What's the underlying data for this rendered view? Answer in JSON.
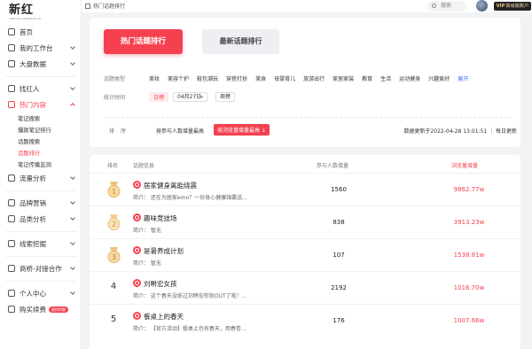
{
  "logo": {
    "main": "新红",
    "sub": "XINHONG.NEWRANK.CN"
  },
  "sidebar": {
    "items": [
      {
        "label": "首页",
        "icon": "home-icon",
        "arrow": false
      },
      {
        "label": "我的工作台",
        "icon": "workbench-icon",
        "arrow": true
      },
      {
        "label": "大盘数据",
        "icon": "dashboard-icon",
        "arrow": true
      },
      {
        "label": "找红人",
        "icon": "user-search-icon",
        "arrow": true
      },
      {
        "label": "热门内容",
        "icon": "hot-content-icon",
        "arrow": true,
        "active": true
      }
    ],
    "sub_items": [
      {
        "label": "笔记搜索"
      },
      {
        "label": "爆款笔记排行"
      },
      {
        "label": "话题搜索"
      },
      {
        "label": "话题排行",
        "active": true
      },
      {
        "label": "笔记传播监测"
      }
    ],
    "items2": [
      {
        "label": "流量分析",
        "icon": "traffic-icon"
      },
      {
        "label": "品牌营销",
        "icon": "brand-icon"
      },
      {
        "label": "品类分析",
        "icon": "category-icon"
      },
      {
        "label": "线索挖掘",
        "icon": "clue-icon"
      },
      {
        "label": "商桥-对接合作",
        "icon": "handshake-icon"
      },
      {
        "label": "个人中心",
        "icon": "person-icon"
      },
      {
        "label": "购买续费",
        "icon": "cart-icon",
        "badge": "限时特惠"
      }
    ]
  },
  "topbar": {
    "breadcrumb": "热门话题排行",
    "search_placeholder": "搜索",
    "vip_prefix": "VIP",
    "vip_label": "高级版账户"
  },
  "tabs": {
    "hot": "热门话题排行",
    "new": "最新话题排行"
  },
  "filters": {
    "type_label": "话题类型",
    "types": [
      "美妆",
      "美容个护",
      "鞋包潮玩",
      "穿搭打扮",
      "美食",
      "母婴育儿",
      "旅游出行",
      "家居家装",
      "教育",
      "生活",
      "运动健身",
      "兴趣爱好"
    ],
    "expand": "展开",
    "time_label": "统计时间",
    "day": "日榜",
    "date": "04月27日",
    "week": "周榜"
  },
  "sort": {
    "label": "排序",
    "option1": "按参与人数增量最高",
    "option2": "按浏览量增量最高 ↓",
    "update_time": "数据更新于2022-04-28 13:01:51 ｜ 每日更新"
  },
  "table": {
    "headers": [
      "排名",
      "话题信息",
      "参与人数增量",
      "浏览量增量"
    ],
    "rows": [
      {
        "rank": "1",
        "medal": "gold",
        "name": "居家健身离能绕震",
        "desc": "简介： 还在为居家emo？一份身心健康锦囊送...",
        "people": "1560",
        "views": "9862.77w"
      },
      {
        "rank": "2",
        "medal": "gold2",
        "name": "趣味竞技场",
        "desc": "简介： 暂无",
        "people": "838",
        "views": "3913.23w"
      },
      {
        "rank": "3",
        "medal": "gold3",
        "name": "是暑养成计划",
        "desc": "简介： 暂无",
        "people": "107",
        "views": "1538.81w"
      },
      {
        "rank": "4",
        "medal": "",
        "name": "刘畊宏女孩",
        "desc": "简介： 这个春天没练过刘畊宏你就OUT了啦！...",
        "people": "2192",
        "views": "1016.70w"
      },
      {
        "rank": "5",
        "medal": "",
        "name": "餐桌上的春天",
        "desc": "简介： 【官方活动】餐桌上也有春天，用春卷...",
        "people": "176",
        "views": "1007.66w"
      }
    ]
  }
}
